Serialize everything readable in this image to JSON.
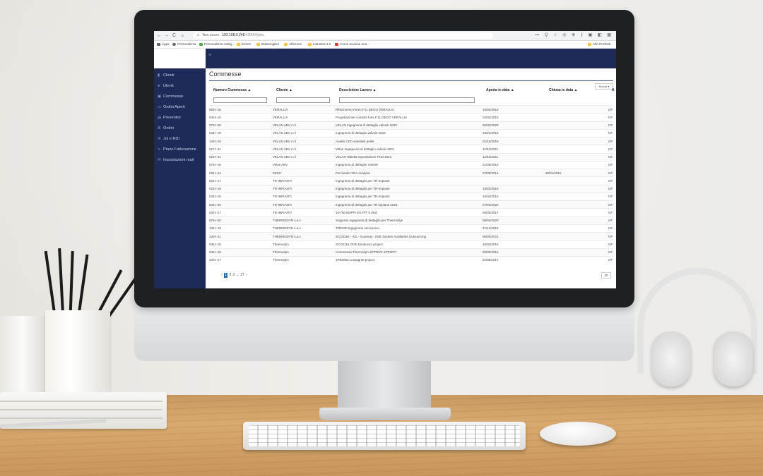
{
  "browser": {
    "nav_icons": [
      "←",
      "→",
      "C",
      "⌂"
    ],
    "url_security": "Non sicuro",
    "url_host": "192.168.0.248",
    "url_path": ":4200/#/jobs",
    "extension_icons": "⊶ Q ☆ ◎ ⊕ ⨍ ▣ ◧ ▦",
    "bookmarks": [
      "Apps",
      "Personalizza",
      "Personalizza colleg...",
      "Eventi",
      "Bakertogliez",
      "Alfemem",
      "Industria 4.0",
      "Come avviene una..."
    ],
    "bookmarks_right": "Altri Preferiti"
  },
  "sidebar": {
    "items": [
      {
        "label": "Clienti",
        "icon": "users-icon"
      },
      {
        "label": "Utenti",
        "icon": "user-icon"
      },
      {
        "label": "Commesse",
        "icon": "briefcase-icon"
      },
      {
        "label": "Ordini Aperti",
        "icon": "folder-open-icon"
      },
      {
        "label": "Preventivi",
        "icon": "calculator-icon"
      },
      {
        "label": "Ordini",
        "icon": "list-icon"
      },
      {
        "label": "Jol e RDI",
        "icon": "gear-icon"
      },
      {
        "label": "Piano Fatturazione",
        "icon": "chart-line-icon"
      },
      {
        "label": "Impostazioni mail",
        "icon": "envelope-icon"
      }
    ]
  },
  "main": {
    "title": "Commesse",
    "new_button": "Nuovo ▾",
    "columns": [
      "Numero Commessa ▲",
      "Cliente ▲",
      "Descrizione Lavoro ▲",
      "Aperta in data ▲",
      "Chiusa in data ▲",
      "A"
    ],
    "rows": [
      [
        "050-I-16",
        "VERALLIA",
        "Rifacimento Forno F11 DEGO VERALLIA",
        "15/04/2016",
        "",
        "GF"
      ],
      [
        "030-I-15",
        "VERALLIA",
        "Progettazione condotti fumi F.11 DEGO VERALLIA",
        "04/02/2015",
        "",
        "GF"
      ],
      [
        "070-I-20",
        "VELAN ABV s.r.l",
        "VELAN Ingegneria di dettaglio valvole 2020",
        "06/03/2020",
        "",
        "GF"
      ],
      [
        "034-I-19",
        "VELAN ABV s.r.l",
        "Ingegneria di dettaglio valvole 2019",
        "16/01/2019",
        "",
        "GF"
      ],
      [
        "143-I-18",
        "VELAN ABV s.r.l",
        "Analisi CFD valvole/k pellet",
        "01/10/2018",
        "",
        "GF"
      ],
      [
        "027-I-21",
        "VELAN ABV s.r.l",
        "Velan Ingegneria di dettaglio valvole 2021",
        "11/01/2021",
        "",
        "GF"
      ],
      [
        "023-I-21",
        "VELAN ABV s.r.l",
        "VELAN Tabella Importazione PLM 2021",
        "11/01/2021",
        "",
        "GF"
      ],
      [
        "078-I-18",
        "Velan ABV",
        "Ingegneria di dettaglio Valvole",
        "21/06/2018",
        "",
        "GF"
      ],
      [
        "031-I-14",
        "EZUC",
        "Pre-heater FEA Analysis",
        "07/02/2014",
        "29/01/2016",
        "GF"
      ],
      [
        "001-I-17",
        "TR IMPIANTI",
        "Ingegneria di dettaglio per TR-Impianti",
        "",
        "",
        "GF"
      ],
      [
        "022-I-19",
        "TR IMPIANTI",
        "Ingegneria di dettaglio per TR-Impianti",
        "15/01/2019",
        "",
        "GF"
      ],
      [
        "033-I-16",
        "TR IMPIANTI",
        "Ingegneria di dettaglio per TR-Impianti",
        "15/03/2016",
        "",
        "GF"
      ],
      [
        "002-I-20",
        "TR IMPIANTI",
        "Ingegneria di dettaglio per TR impianti 2020",
        "07/02/2020",
        "",
        "GF"
      ],
      [
        "032-I-17",
        "TR IMPIANTI",
        "10-750 ENPPI EGYPT 5 skid",
        "05/02/2017",
        "",
        "GF"
      ],
      [
        "076-I-20",
        "THERMODYN s.a.s",
        "Supporto ingegneria di dettaglio per Thermodyn",
        "06/04/2020",
        "",
        "GF"
      ],
      [
        "102-I-19",
        "THERMODYN s.a.s",
        "TM2230 Ingegneria meccanica",
        "31/10/2019",
        "",
        "GF"
      ],
      [
        "100-I-21",
        "THERMODYN s.a.s",
        "SCO2262 - IGL - Gournay - ASE System Auxiliaries Outsourcing",
        "06/04/2021",
        "",
        "GF"
      ],
      [
        "036-I-15",
        "Thermodyn",
        "SCO2116 OGE Emaluven project",
        "16/03/2015",
        "",
        "GF"
      ],
      [
        "046-I-15",
        "Thermodyn",
        "Commessa Thermodyn 1PP0074-1PP0077",
        "06/02/2015",
        "",
        "GF"
      ],
      [
        "100-I-17",
        "Thermodyn",
        "1PE0003 Lussagnet project",
        "21/09/2017",
        "",
        "GF"
      ]
    ],
    "pagination": [
      "‹",
      "1",
      "2",
      "3",
      "...",
      "37",
      "›"
    ],
    "page_size": "20"
  }
}
